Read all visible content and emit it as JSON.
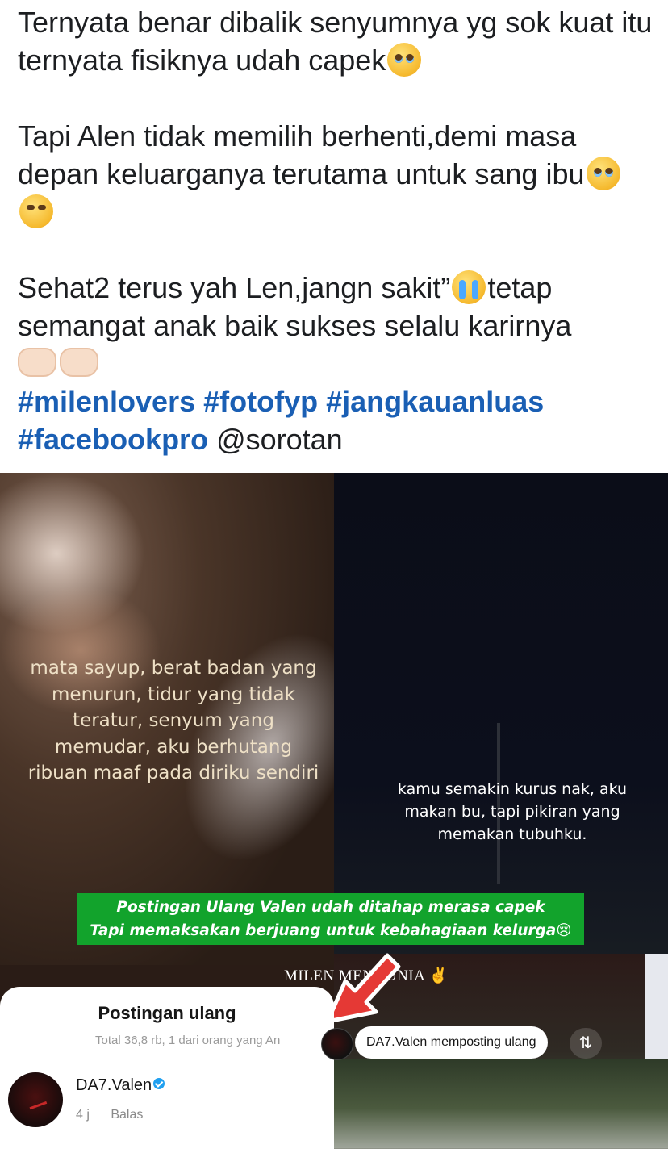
{
  "caption": {
    "para1": "Ternyata benar dibalik senyumnya yg sok kuat itu ternyata fisiknya udah capek",
    "para1_emoji": "pleading-face-icon",
    "para2": "Tapi Alen tidak memilih berhenti,demi masa depan keluarganya terutama untuk sang ibu",
    "para2_emojis": [
      "pleading-face-icon",
      "smiling-tear-icon"
    ],
    "para3_a": "Sehat2 terus yah Len,jangn sakit”",
    "para3_b": "tetap semangat anak baik sukses selalu karirnya",
    "para3_emojis": [
      "loudly-crying-icon",
      "heart-hands-icon",
      "raising-hands-icon"
    ],
    "hashtags": [
      "#milenlovers",
      "#fotofyp",
      "#jangkauanluas",
      "#facebookpro"
    ],
    "mention": "@sorotan"
  },
  "photo": {
    "left_overlay_text": "mata sayup, berat badan yang menurun, tidur yang tidak teratur, senyum yang memudar, aku berhutang ribuan maaf pada diriku sendiri",
    "right_overlay_text": "kamu semakin kurus nak, aku makan bu, tapi pikiran yang memakan tubuhku.",
    "banner_line1": "Postingan Ulang Valen udah ditahap merasa capek",
    "banner_line2": "Tapi memaksakan berjuang untuk kebahagiaan kelurga",
    "banner_emoji": "pleading-face-icon",
    "watermark": "MILEN MENDUNIA",
    "watermark_emoji": "rock-hand-icon",
    "arrow_color": "#e53935"
  },
  "repost_panel": {
    "title": "Postingan ulang",
    "subtitle": "Total 36,8 rb, 1 dari orang yang An",
    "user": "DA7.Valen",
    "time": "4 j",
    "reply_label": "Balas"
  },
  "repost_pill": {
    "label": "DA7.Valen memposting ulang",
    "icon": "repost-icon"
  }
}
